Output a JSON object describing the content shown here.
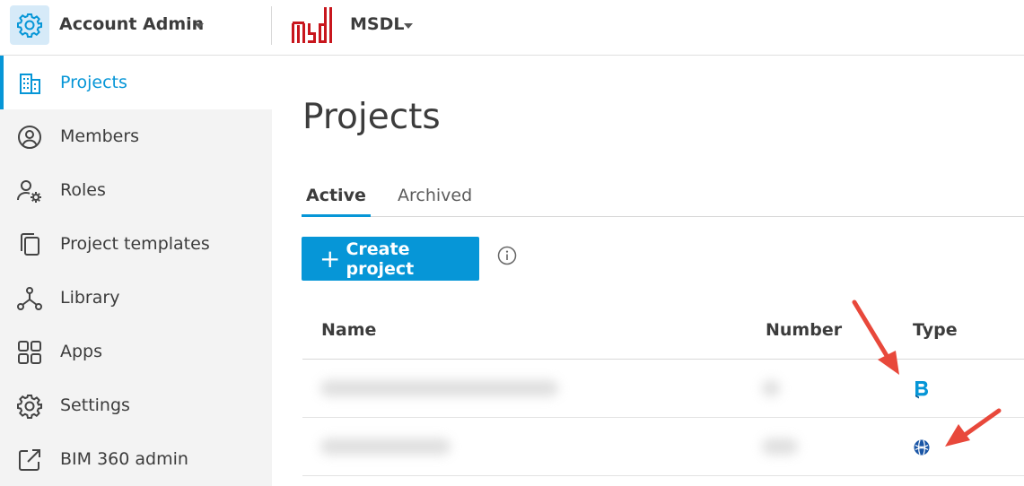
{
  "header": {
    "account_name": "Account Admin",
    "org_name": "MSDL",
    "logo_text": "msdl"
  },
  "colors": {
    "accent": "#0696d7",
    "annotation_arrow": "#e8483b"
  },
  "sidebar": {
    "items": [
      {
        "label": "Projects",
        "icon": "building-icon",
        "active": true
      },
      {
        "label": "Members",
        "icon": "user-circle-icon",
        "active": false
      },
      {
        "label": "Roles",
        "icon": "user-gear-icon",
        "active": false
      },
      {
        "label": "Project templates",
        "icon": "copy-icon",
        "active": false
      },
      {
        "label": "Library",
        "icon": "network-icon",
        "active": false
      },
      {
        "label": "Apps",
        "icon": "grid-icon",
        "active": false
      },
      {
        "label": "Settings",
        "icon": "gear-icon",
        "active": false
      },
      {
        "label": "BIM 360 admin",
        "icon": "external-link-icon",
        "active": false
      }
    ]
  },
  "main": {
    "title": "Projects",
    "tabs": [
      {
        "label": "Active",
        "active": true
      },
      {
        "label": "Archived",
        "active": false
      }
    ],
    "create_button": "Create project",
    "table": {
      "columns": [
        "Name",
        "Number",
        "Type"
      ],
      "rows": [
        {
          "type_icon": "bim360-icon"
        },
        {
          "type_icon": "acc-globe-icon"
        }
      ]
    }
  }
}
